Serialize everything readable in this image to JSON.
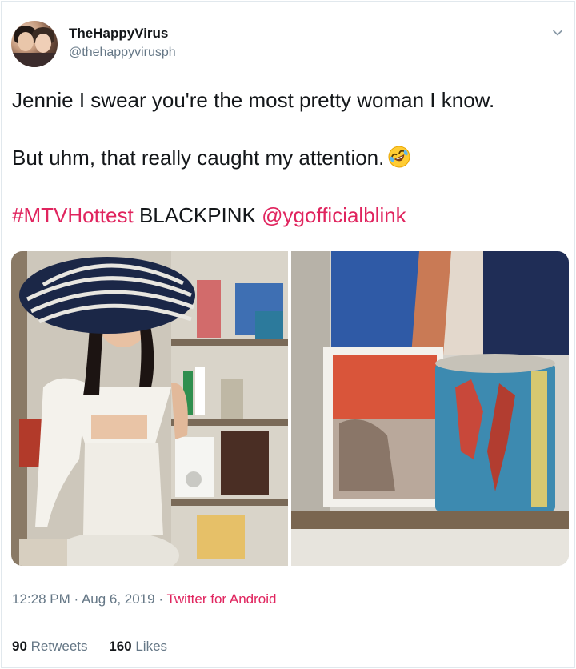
{
  "author": {
    "name": "TheHappyVirus",
    "handle": "@thehappyvirusph"
  },
  "tweet": {
    "line1": "Jennie I swear you're the most pretty woman I know.",
    "line2": "But uhm, that really caught my attention.",
    "emoji": "rolling-on-the-floor-laughing",
    "hashtag": "#MTVHottest",
    "plain": " BLACKPINK ",
    "mention": "@ygofficialblink"
  },
  "meta": {
    "time": "12:28 PM",
    "sep1": " · ",
    "date": "Aug 6, 2019",
    "sep2": " · ",
    "source": "Twitter for Android"
  },
  "stats": {
    "retweets_count": "90",
    "retweets_label": " Retweets",
    "likes_count": "160",
    "likes_label": " Likes"
  },
  "colors": {
    "link": "#e0245e",
    "secondary": "#657786",
    "text": "#14171a"
  },
  "icons": [
    "chevron-down-icon",
    "laughing-emoji-icon"
  ]
}
